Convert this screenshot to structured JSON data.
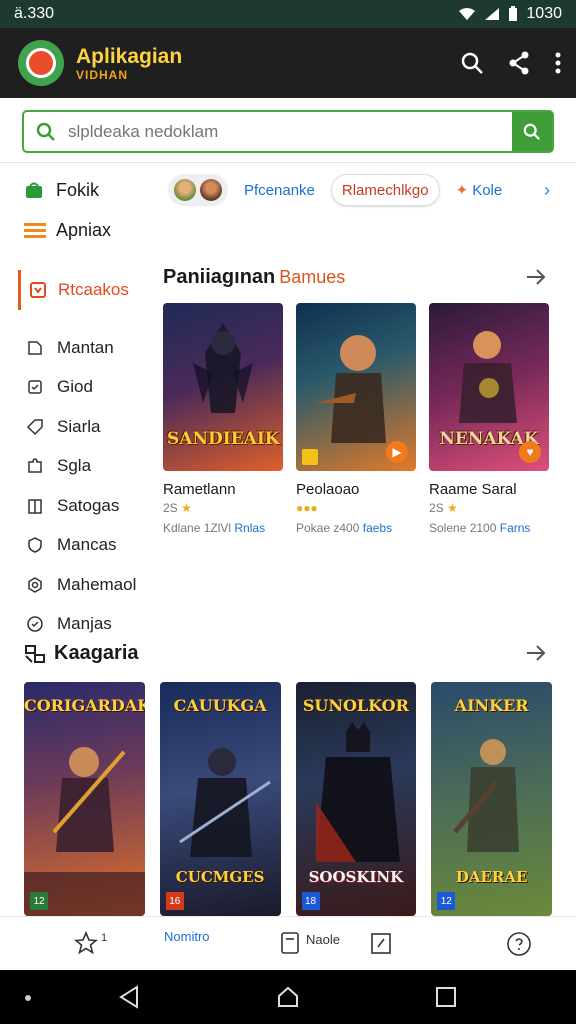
{
  "status": {
    "time": "ä.330",
    "clock": "1030"
  },
  "app": {
    "title": "Aplikagian",
    "subtitle": "VIDHAN"
  },
  "search": {
    "placeholder": "slpldeaka nedoklam"
  },
  "sidebar": {
    "top": [
      {
        "label": "Fokik",
        "icon": "store-icon"
      },
      {
        "label": "Apniax",
        "icon": "menu-icon"
      }
    ],
    "active": {
      "label": "Rtcaakos",
      "icon": "bookmark-icon"
    },
    "items": [
      {
        "label": "Mantan",
        "icon": "puzzle-icon"
      },
      {
        "label": "Giod",
        "icon": "square-icon"
      },
      {
        "label": "Siarla",
        "icon": "tag-icon"
      },
      {
        "label": "Sgla",
        "icon": "puzzle-piece-icon"
      },
      {
        "label": "Satogas",
        "icon": "book-icon"
      },
      {
        "label": "Mancas",
        "icon": "shield-icon"
      },
      {
        "label": "Mahemaol",
        "icon": "hexagon-icon"
      },
      {
        "label": "Manjas",
        "icon": "circle-check-icon"
      }
    ]
  },
  "chips": [
    {
      "label": "Pfcenanke"
    },
    {
      "label": "Rlamechlkgo"
    },
    {
      "label": "Kole"
    }
  ],
  "section1": {
    "title": "Paniiagınan",
    "accent": "Bamues"
  },
  "games1": [
    {
      "cover_text": "SANDIEAIK",
      "title": "Rametlann",
      "rating": "2S",
      "meta": "Kdlane 1ZlVl",
      "meta_link": "Rnlas",
      "colors": [
        "#2b1f4a",
        "#e0572a"
      ]
    },
    {
      "cover_text": "",
      "title": "Peolaoao",
      "rating": "",
      "meta": "Pokae z400",
      "meta_link": "faebs",
      "colors": [
        "#1b3a5a",
        "#d4621f"
      ]
    },
    {
      "cover_text": "NENAKAK",
      "title": "Raame Saral",
      "rating": "2S",
      "meta": "Solene 2100",
      "meta_link": "Farns",
      "colors": [
        "#3a1f3a",
        "#c8466a"
      ]
    }
  ],
  "section2": {
    "title": "Kaagaria"
  },
  "games2": [
    {
      "head": "CORIGARDAK",
      "foot": "",
      "colors": [
        "#3a2a6a",
        "#e2682a"
      ]
    },
    {
      "head": "CAUUKGA",
      "foot": "CUCMGES",
      "colors": [
        "#1a2a4a",
        "#5a7ab0"
      ]
    },
    {
      "head": "SUNOLKOR",
      "foot": "SOOSKINK",
      "colors": [
        "#1c2436",
        "#a23a1e"
      ]
    },
    {
      "head": "AINKER",
      "foot": "DAERAE",
      "colors": [
        "#2a4a5a",
        "#8ab060"
      ]
    }
  ],
  "bottom_nav": {
    "star_count": "1",
    "active_label": "Nomitro",
    "label2": "Naole"
  }
}
